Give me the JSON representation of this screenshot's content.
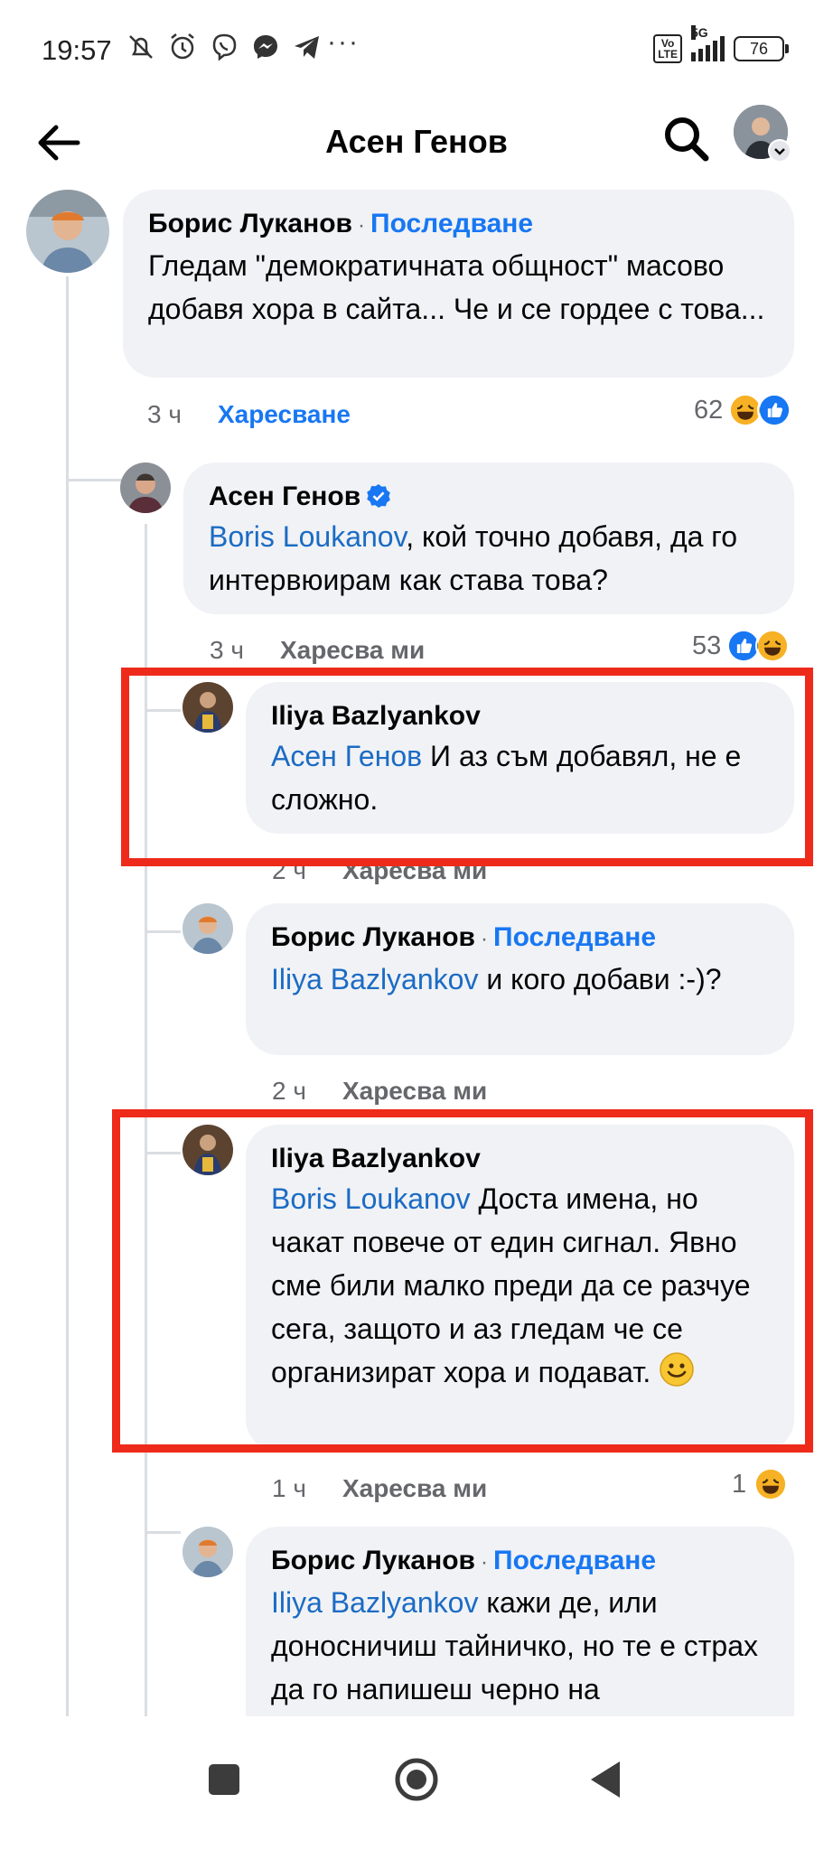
{
  "status_bar": {
    "time": "19:57",
    "more": "···",
    "network": "5G",
    "volte": "Vo LTE",
    "battery": "76"
  },
  "header": {
    "title": "Асен Генов"
  },
  "comments": [
    {
      "author": "Борис Луканов",
      "follow": "Последване",
      "text": "Гледам \"демократичната общност\" масово добавя хора в сайта... Че и се гордее с това...",
      "time": "3 ч",
      "action": "Харесване",
      "reaction_count": "62"
    },
    {
      "author": "Асен Генов",
      "mention": "Boris Loukanov",
      "text": ", кой точно добавя, да го интервюирам как става това?",
      "time": "3 ч",
      "action": "Харесва ми",
      "reaction_count": "53"
    },
    {
      "author": "Iliya Bazlyankov",
      "mention": "Асен Генов",
      "text": " И аз съм добавял, не е сложно.",
      "time": "2 ч",
      "action": "Харесва ми"
    },
    {
      "author": "Борис Луканов",
      "follow": "Последване",
      "mention": "Iliya Bazlyankov",
      "text": " и кого добави :-)?",
      "time": "2 ч",
      "action": "Харесва ми"
    },
    {
      "author": "Iliya Bazlyankov",
      "mention": "Boris Loukanov",
      "text": " Доста имена, но чакат повече от един сигнал. Явно сме били малко преди да се разчуе сега, защото и аз гледам че се организират хора и подават. ",
      "time": "1 ч",
      "action": "Харесва ми",
      "reaction_count": "1"
    },
    {
      "author": "Борис Луканов",
      "follow": "Последване",
      "mention": "Iliya Bazlyankov",
      "text": " кажи де, или доносничиш тайничко, но те е страх да го напишеш черно на"
    }
  ],
  "colors": {
    "link": "#1877f2",
    "mention": "#1b6bc4",
    "bubble": "#f0f2f5",
    "highlight": "#ee2a1b"
  },
  "icons": [
    "back-arrow-icon",
    "search-icon",
    "verified-badge-icon",
    "haha-reaction-icon",
    "like-reaction-icon",
    "smile-emoji-icon"
  ]
}
